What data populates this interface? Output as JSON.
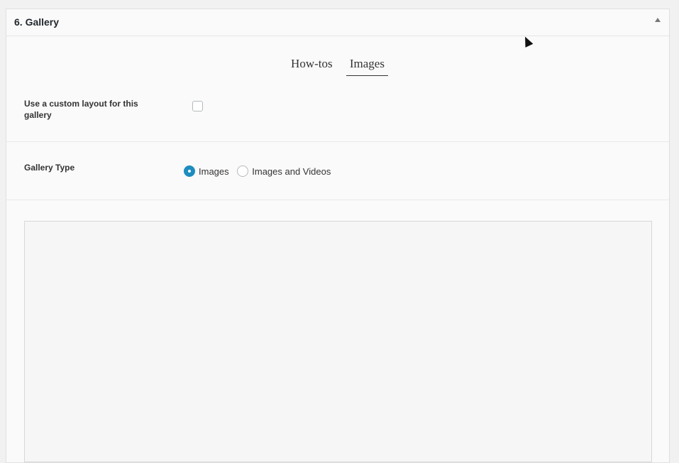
{
  "panel": {
    "title": "6. Gallery"
  },
  "tabs": [
    {
      "label": "How-tos",
      "active": false
    },
    {
      "label": "Images",
      "active": true
    }
  ],
  "custom_layout": {
    "label": "Use a custom layout for this gallery",
    "checked": false
  },
  "gallery_type": {
    "label": "Gallery Type",
    "options": [
      {
        "label": "Images",
        "checked": true
      },
      {
        "label": "Images and Videos",
        "checked": false
      }
    ]
  },
  "colors": {
    "accent": "#1e8cbe"
  }
}
